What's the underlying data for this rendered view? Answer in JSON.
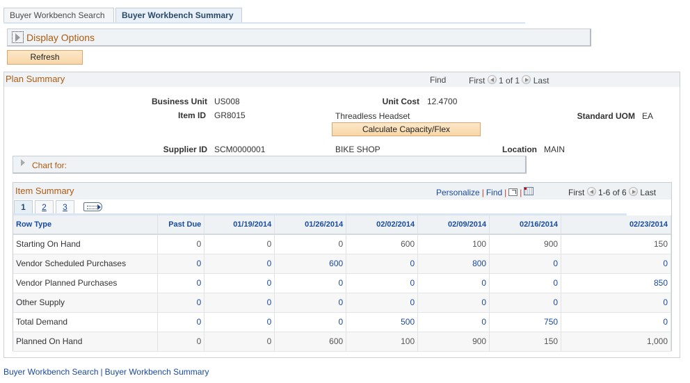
{
  "tabs": [
    {
      "label": "Buyer Workbench Search",
      "active": false
    },
    {
      "label": "Buyer Workbench Summary",
      "active": true
    }
  ],
  "display_options": {
    "label": "Display Options"
  },
  "refresh_button": "Refresh",
  "plan_summary": {
    "title": "Plan Summary",
    "find": "Find",
    "first": "First",
    "pager": "1 of 1",
    "last": "Last",
    "fields": {
      "business_unit": {
        "label": "Business Unit",
        "value": "US008"
      },
      "unit_cost": {
        "label": "Unit Cost",
        "value": "12.4700"
      },
      "item_id": {
        "label": "Item ID",
        "value": "GR8015"
      },
      "item_description": "Threadless Headset",
      "standard_uom": {
        "label": "Standard UOM",
        "value": "EA"
      },
      "supplier_id": {
        "label": "Supplier ID",
        "value": "SCM0000001"
      },
      "supplier_name": "BIKE SHOP",
      "location": {
        "label": "Location",
        "value": "MAIN"
      }
    },
    "calc_button": "Calculate Capacity/Flex",
    "chart_for": "Chart for:"
  },
  "item_summary": {
    "title": "Item Summary",
    "personalize": "Personalize",
    "find": "Find",
    "first": "First",
    "pager": "1-6 of 6",
    "last": "Last",
    "page_tabs": [
      "1",
      "2",
      "3"
    ],
    "columns": [
      "Row Type",
      "Past Due",
      "01/19/2014",
      "01/26/2014",
      "02/02/2014",
      "02/09/2014",
      "02/16/2014",
      "02/23/2014"
    ],
    "rows": [
      {
        "type": "Starting On Hand",
        "link": false,
        "values": [
          "0",
          "0",
          "0",
          "600",
          "100",
          "900",
          "150"
        ]
      },
      {
        "type": "Vendor Scheduled Purchases",
        "link": true,
        "values": [
          "0",
          "0",
          "600",
          "0",
          "800",
          "0",
          "0"
        ]
      },
      {
        "type": "Vendor Planned Purchases",
        "link": true,
        "values": [
          "0",
          "0",
          "0",
          "0",
          "0",
          "0",
          "850"
        ]
      },
      {
        "type": "Other Supply",
        "link": true,
        "values": [
          "0",
          "0",
          "0",
          "0",
          "0",
          "0",
          "0"
        ]
      },
      {
        "type": "Total Demand",
        "link": true,
        "values": [
          "0",
          "0",
          "0",
          "500",
          "0",
          "750",
          "0"
        ]
      },
      {
        "type": "Planned On Hand",
        "link": false,
        "values": [
          "0",
          "0",
          "600",
          "100",
          "900",
          "150",
          "1,000"
        ]
      }
    ]
  },
  "footer_links": [
    "Buyer Workbench Search",
    "Buyer Workbench Summary"
  ]
}
